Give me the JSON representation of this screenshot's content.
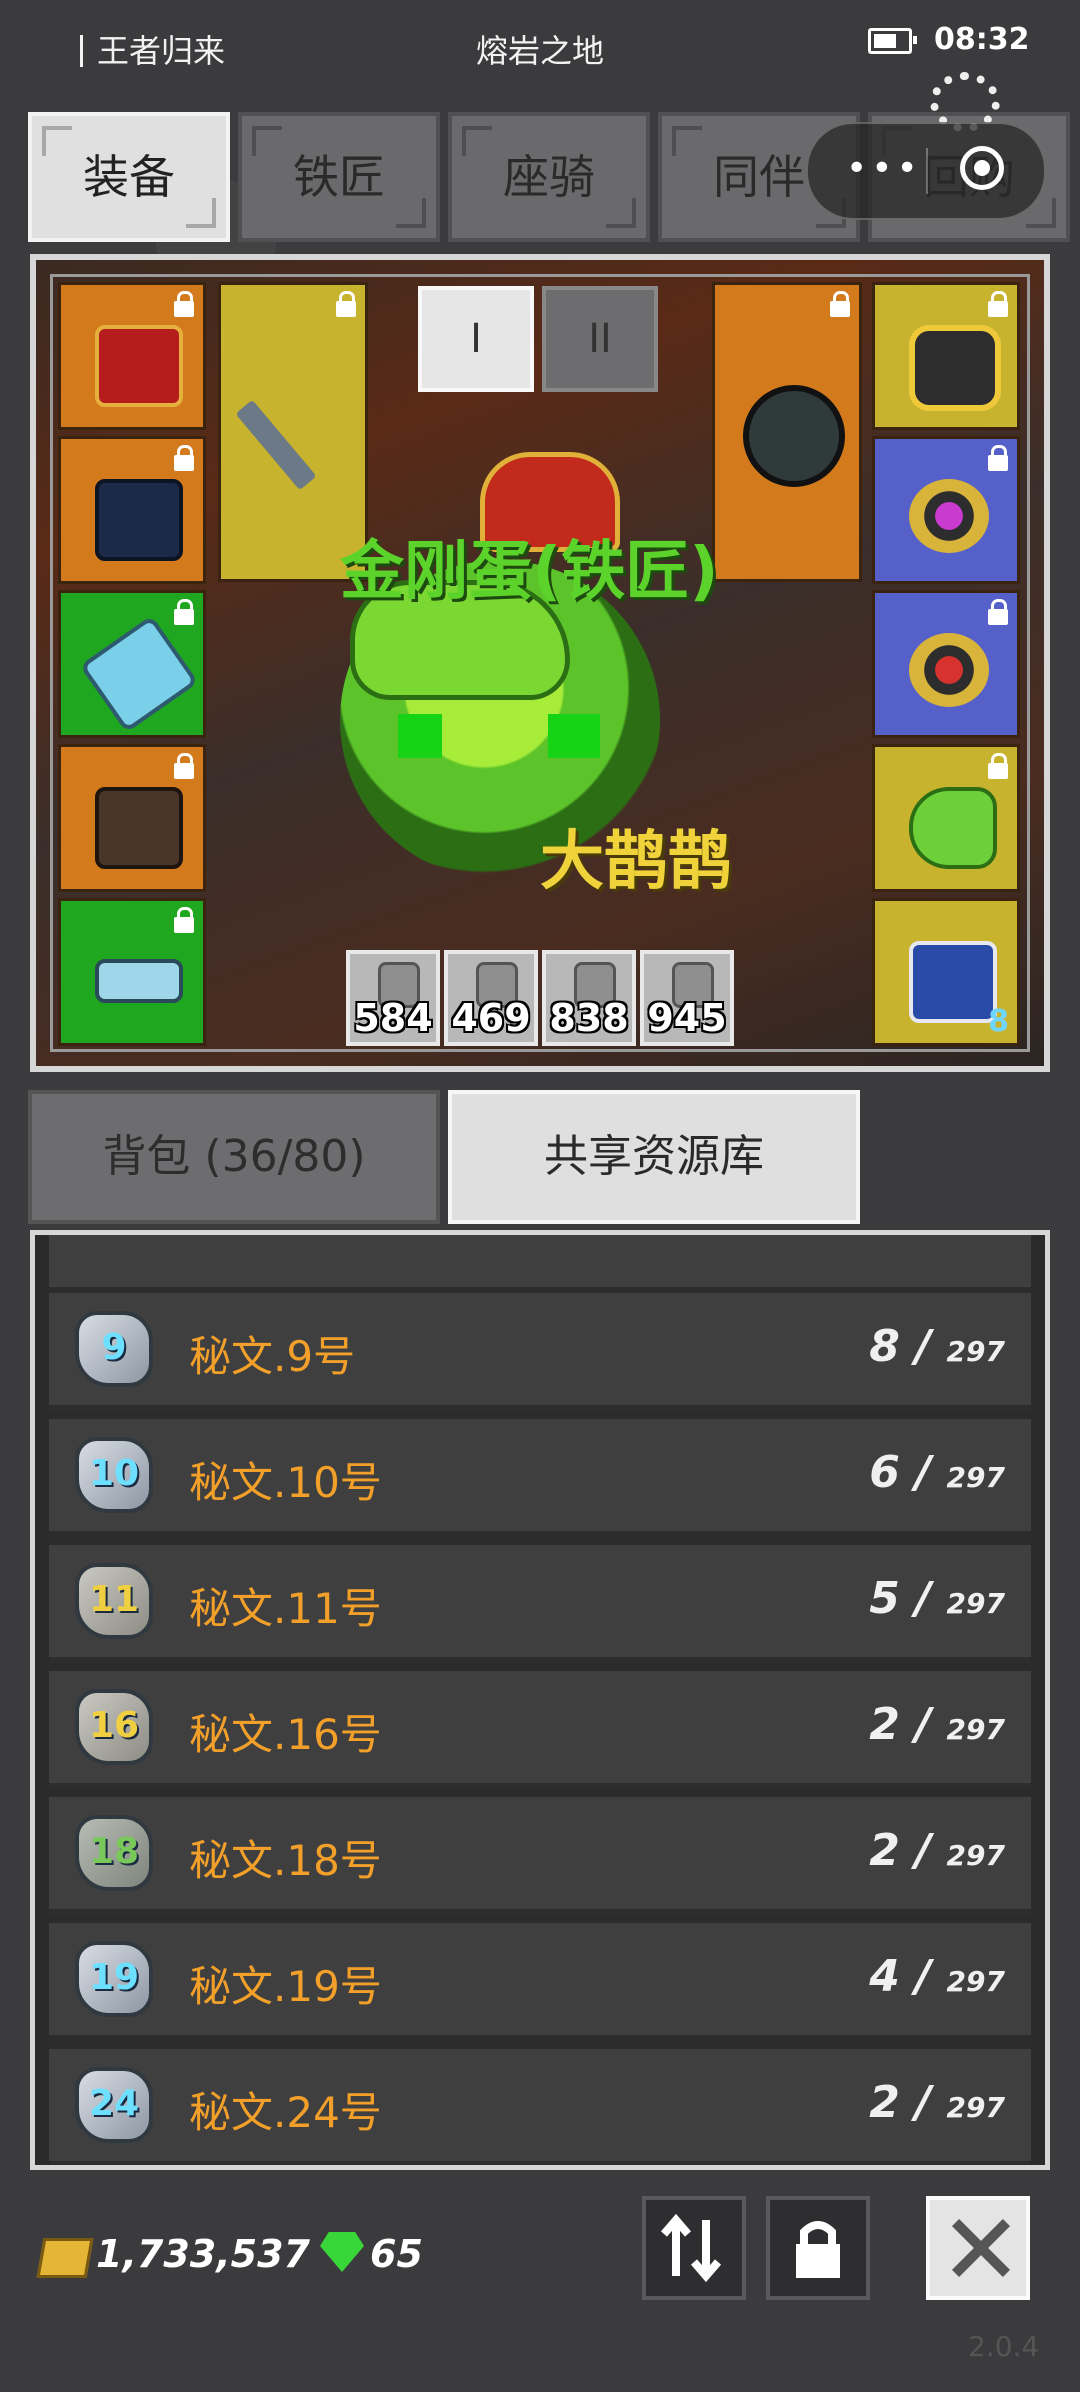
{
  "status_bar": {
    "app_name": "王者归来",
    "location": "熔岩之地",
    "time": "08:32"
  },
  "top_tabs": [
    {
      "label": "装备",
      "active": true
    },
    {
      "label": "铁匠",
      "active": false
    },
    {
      "label": "座骑",
      "active": false
    },
    {
      "label": "同伴",
      "active": false
    },
    {
      "label": "回购",
      "active": false
    }
  ],
  "equipment": {
    "mini_tabs": [
      "I",
      "II"
    ],
    "character_name": "金刚蛋(铁匠)",
    "pet_name": "大鹊鹊",
    "left_slots": [
      "orange",
      "orange",
      "green",
      "orange",
      "green"
    ],
    "right_slots": [
      "yellow",
      "blue",
      "blue",
      "yellow",
      "yellow"
    ],
    "right_corner_count": "8",
    "potions": [
      "584",
      "469",
      "838",
      "945"
    ]
  },
  "bag_tabs": [
    {
      "label": "背包 (36/80)",
      "active": false
    },
    {
      "label": "共享资源库",
      "active": true
    }
  ],
  "resources": [
    {
      "rune": "9",
      "name": "秘文.9号",
      "count": "8",
      "max": "297"
    },
    {
      "rune": "10",
      "name": "秘文.10号",
      "count": "6",
      "max": "297"
    },
    {
      "rune": "11",
      "name": "秘文.11号",
      "count": "5",
      "max": "297"
    },
    {
      "rune": "16",
      "name": "秘文.16号",
      "count": "2",
      "max": "297"
    },
    {
      "rune": "18",
      "name": "秘文.18号",
      "count": "2",
      "max": "297"
    },
    {
      "rune": "19",
      "name": "秘文.19号",
      "count": "4",
      "max": "297"
    },
    {
      "rune": "24",
      "name": "秘文.24号",
      "count": "2",
      "max": "297"
    }
  ],
  "currency": {
    "gold": "1,733,537",
    "gems": "65"
  },
  "version": "2.0.4"
}
